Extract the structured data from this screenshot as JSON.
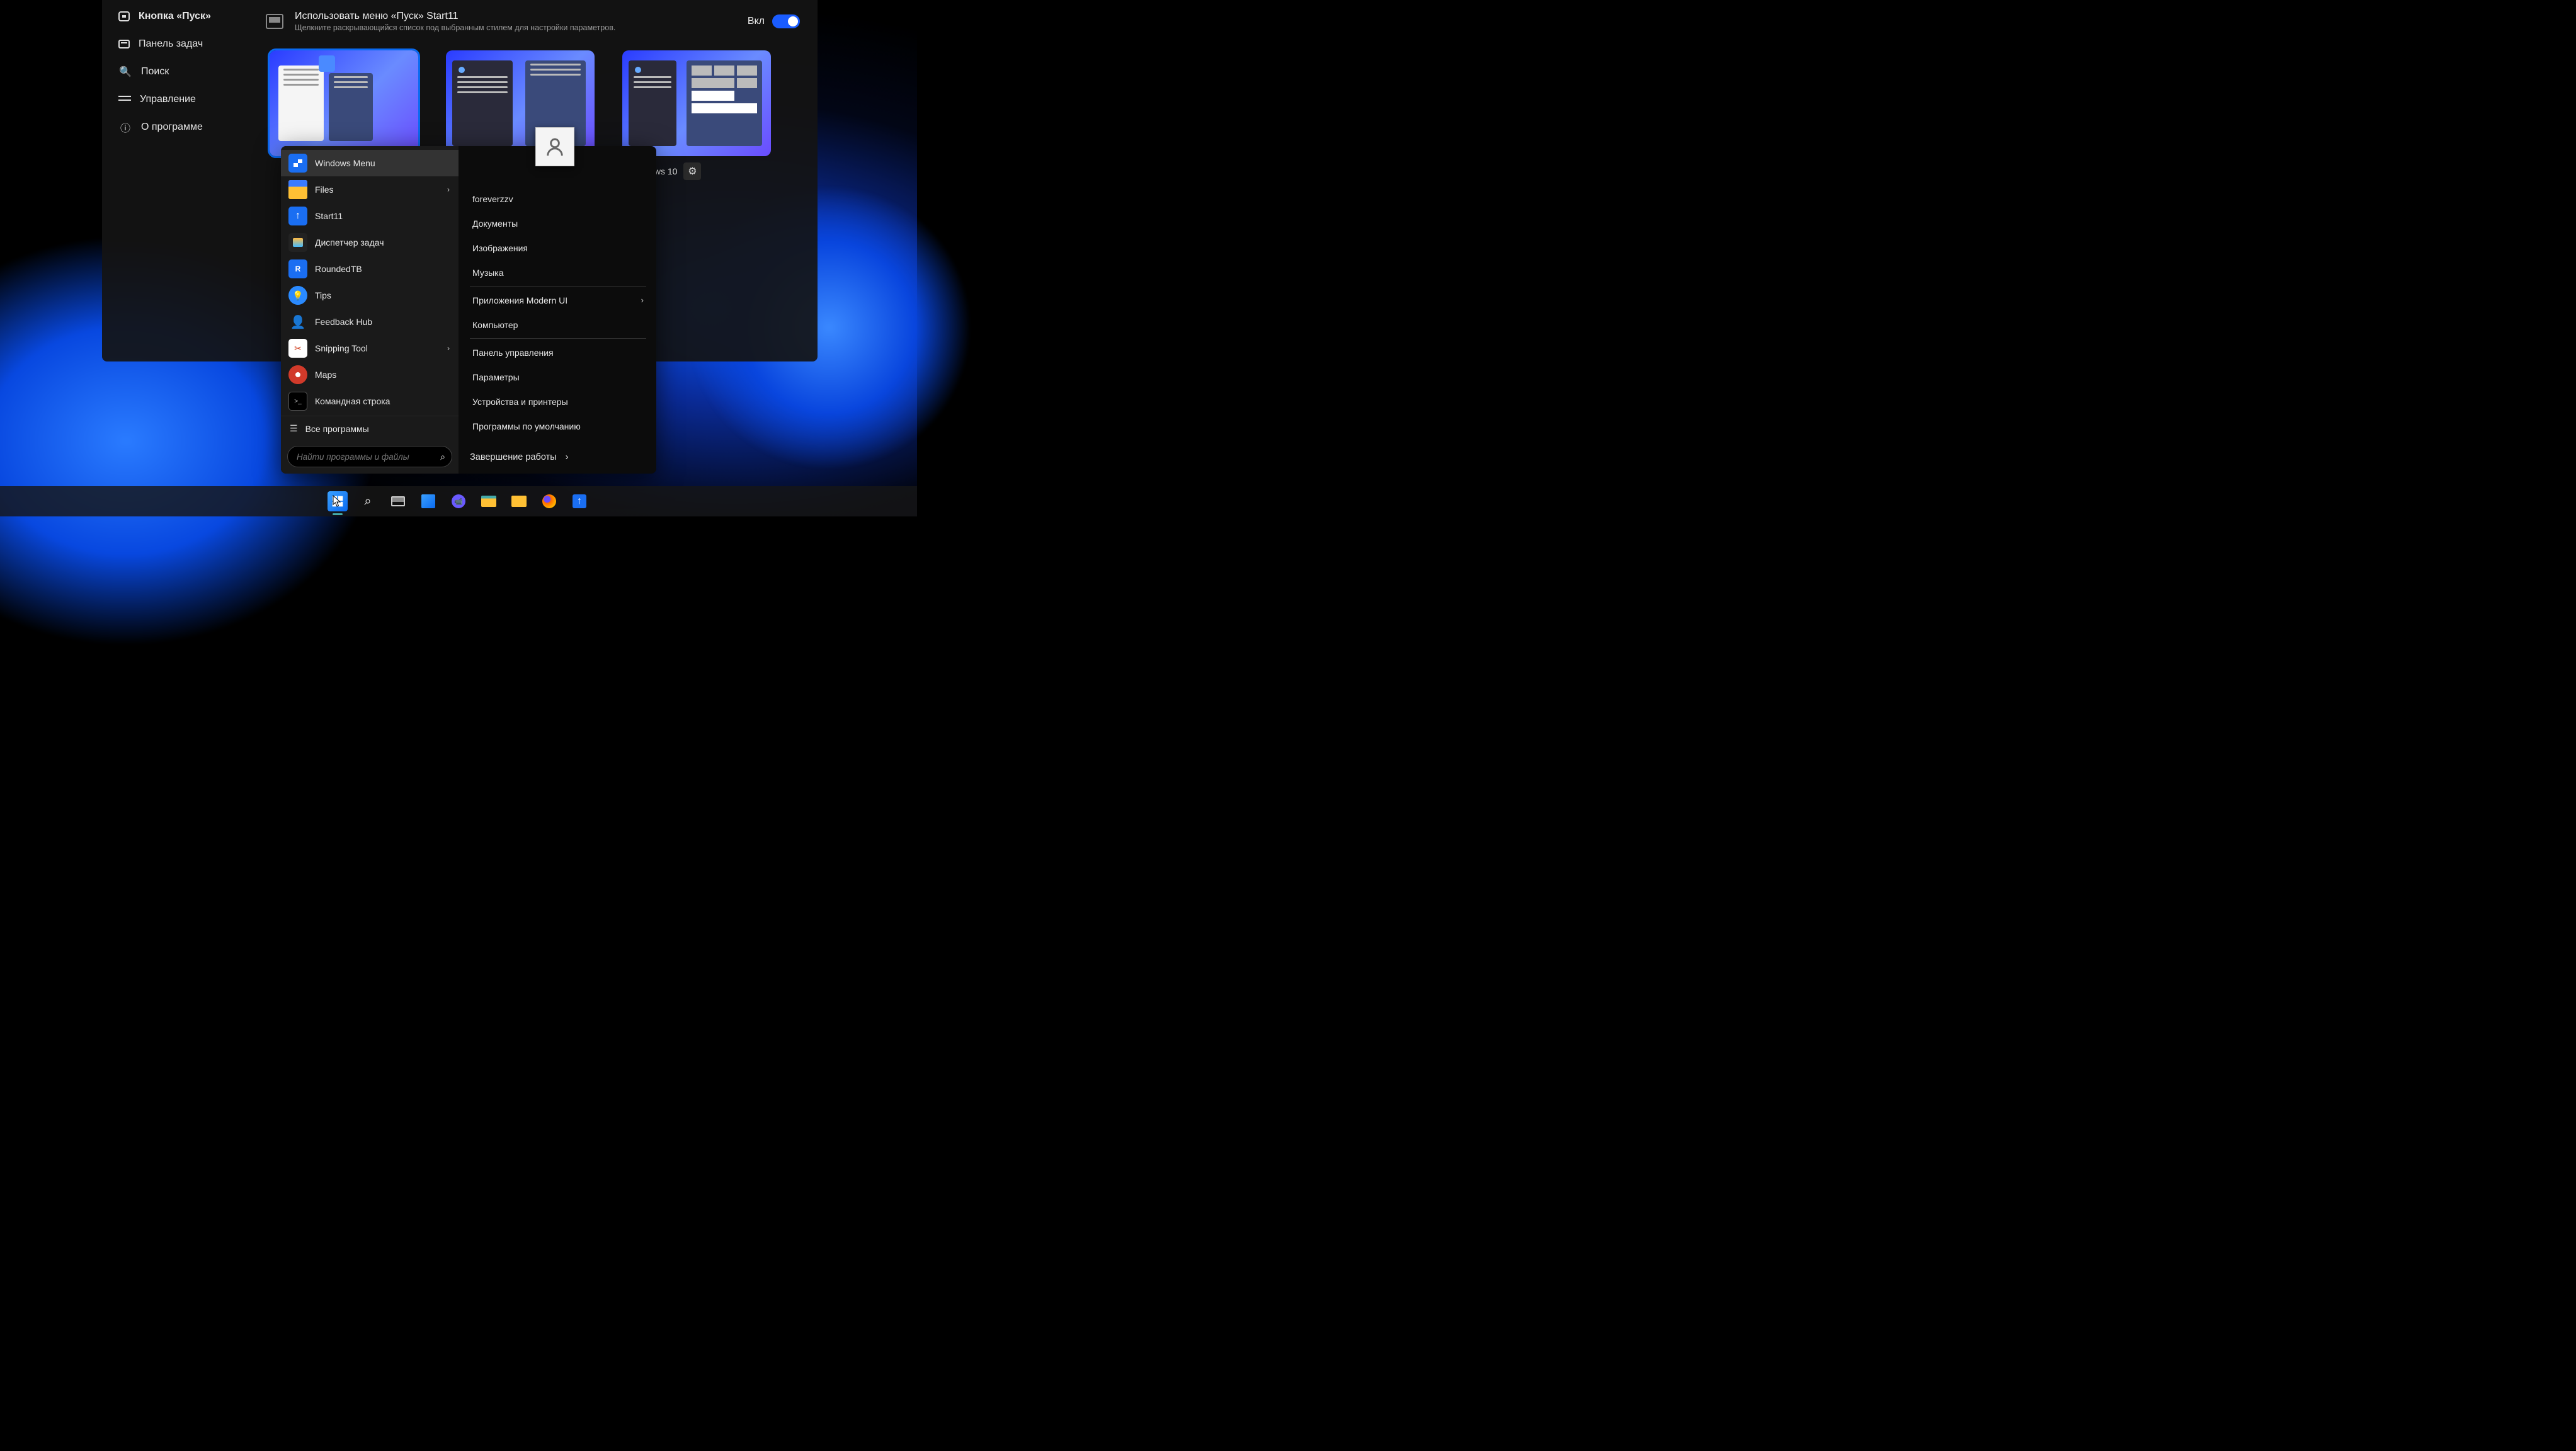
{
  "settings": {
    "sidebar": {
      "items": [
        {
          "label": "Кнопка «Пуск»"
        },
        {
          "label": "Панель задач"
        },
        {
          "label": "Поиск"
        },
        {
          "label": "Управление"
        },
        {
          "label": "О программе"
        }
      ]
    },
    "option": {
      "title": "Использовать меню «Пуск» Start11",
      "subtitle": "Щелкните раскрывающийся список под выбранным стилем для настройки параметров.",
      "toggle_label": "Вкл"
    },
    "styles": {
      "visible_right_label": "ь Windows 10"
    }
  },
  "start_menu": {
    "left": {
      "items": [
        {
          "id": "windows-menu",
          "label": "Windows Menu",
          "icon": "win",
          "selected": true
        },
        {
          "id": "files",
          "label": "Files",
          "icon": "folder",
          "submenu": true
        },
        {
          "id": "start11",
          "label": "Start11",
          "icon": "start11"
        },
        {
          "id": "task-manager",
          "label": "Диспетчер задач",
          "icon": "task"
        },
        {
          "id": "roundedtb",
          "label": "RoundedTB",
          "icon": "rtb"
        },
        {
          "id": "tips",
          "label": "Tips",
          "icon": "tips"
        },
        {
          "id": "feedback-hub",
          "label": "Feedback Hub",
          "icon": "fb"
        },
        {
          "id": "snipping-tool",
          "label": "Snipping Tool",
          "icon": "snip",
          "submenu": true
        },
        {
          "id": "maps",
          "label": "Maps",
          "icon": "maps"
        },
        {
          "id": "cmd",
          "label": "Командная строка",
          "icon": "cmd"
        }
      ],
      "all_programs": "Все программы",
      "search_placeholder": "Найти программы и файлы"
    },
    "right": {
      "username": "foreverzzv",
      "group1": [
        {
          "label": "Документы"
        },
        {
          "label": "Изображения"
        },
        {
          "label": "Музыка"
        }
      ],
      "group2": [
        {
          "label": "Приложения Modern UI",
          "submenu": true
        },
        {
          "label": "Компьютер"
        }
      ],
      "group3": [
        {
          "label": "Панель управления"
        },
        {
          "label": "Параметры"
        },
        {
          "label": "Устройства и принтеры"
        },
        {
          "label": "Программы по умолчанию"
        }
      ],
      "shutdown": "Завершение работы"
    }
  },
  "taskbar": {
    "items": [
      {
        "id": "start",
        "name": "start-button"
      },
      {
        "id": "search",
        "name": "search-icon"
      },
      {
        "id": "taskview",
        "name": "taskview-icon"
      },
      {
        "id": "widgets",
        "name": "widgets-icon"
      },
      {
        "id": "teams",
        "name": "chat-icon"
      },
      {
        "id": "explorer",
        "name": "explorer-icon"
      },
      {
        "id": "folder",
        "name": "folder-icon"
      },
      {
        "id": "firefox",
        "name": "firefox-icon"
      },
      {
        "id": "start11",
        "name": "start11-icon"
      }
    ]
  }
}
